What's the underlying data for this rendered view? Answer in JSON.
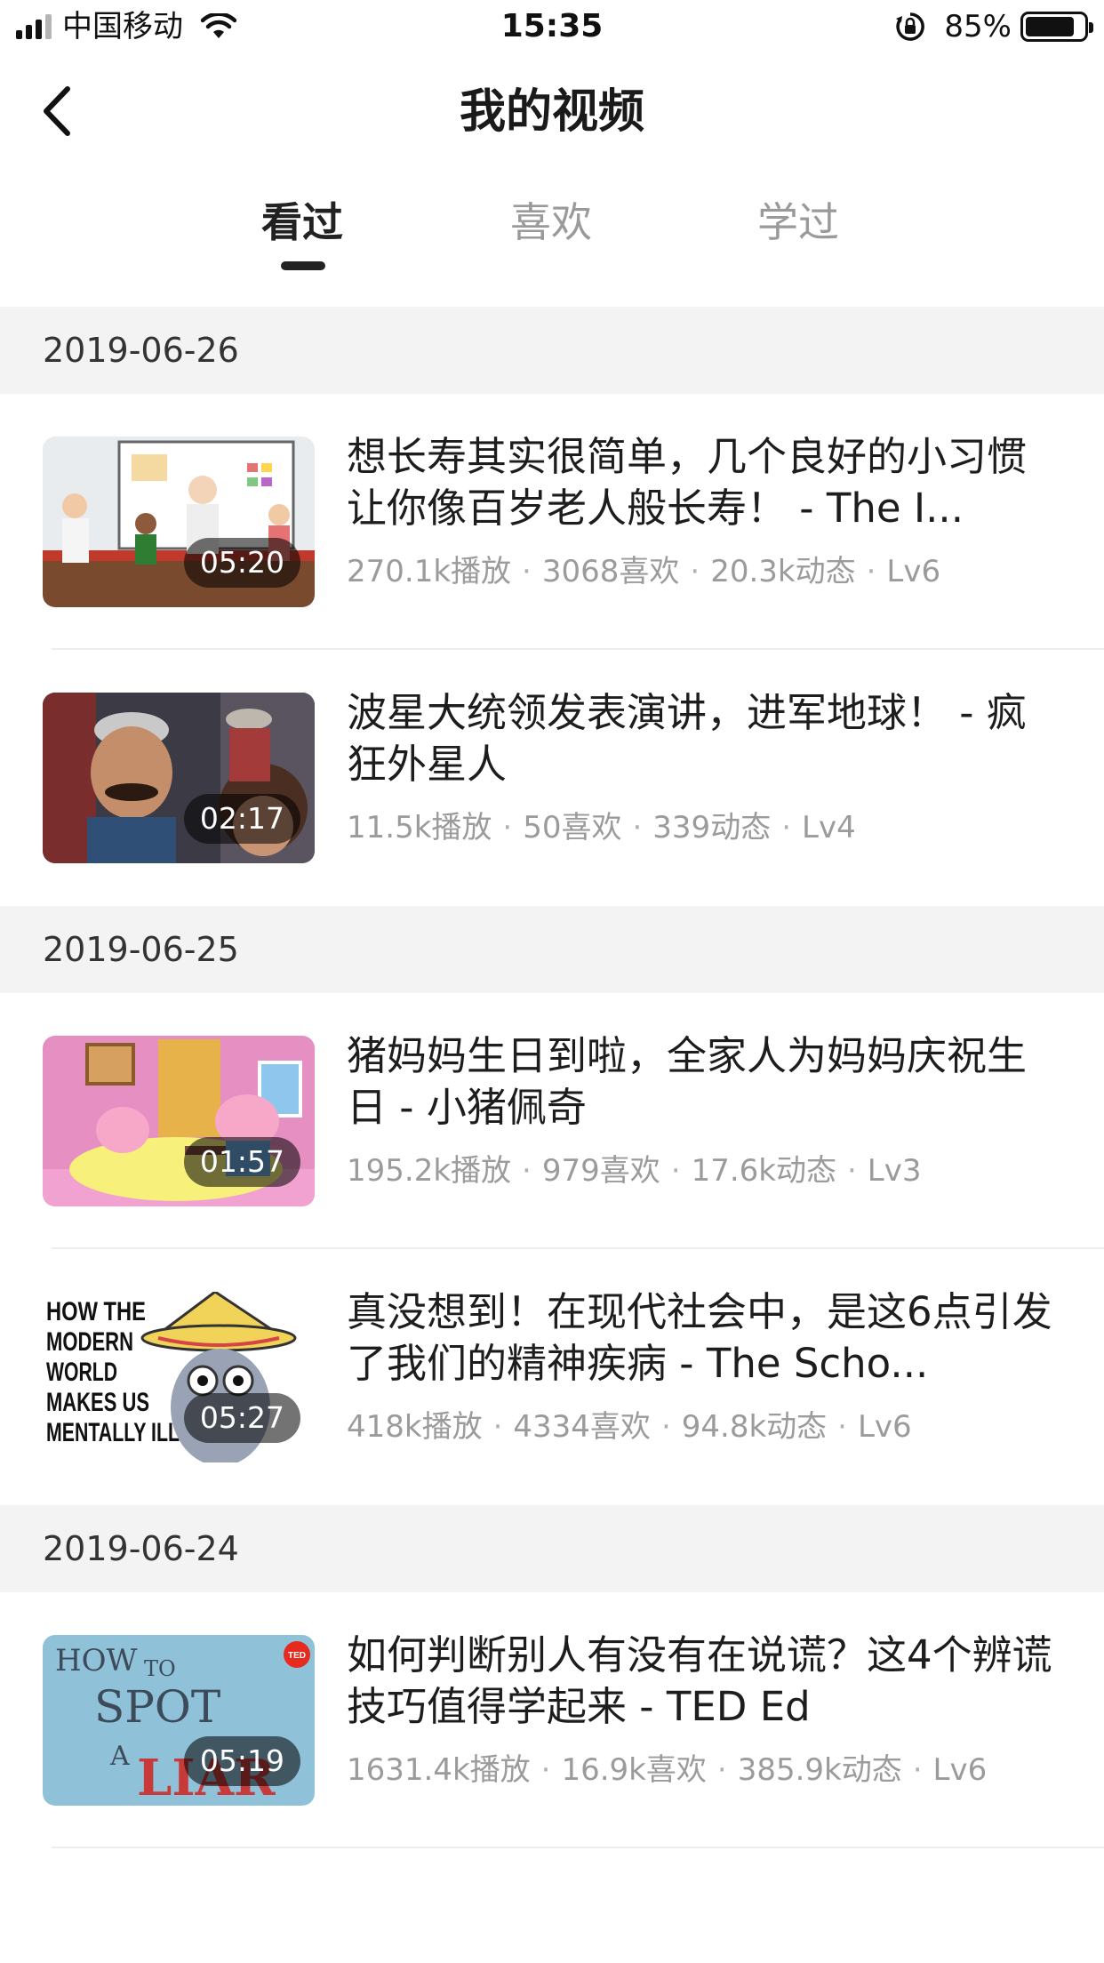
{
  "status_bar": {
    "carrier": "中国移动",
    "time": "15:35",
    "battery": "85%",
    "battery_level": 0.85
  },
  "nav": {
    "title": "我的视频",
    "back_icon": "chevron-left-icon"
  },
  "tabs": [
    {
      "label": "看过",
      "active": true
    },
    {
      "label": "喜欢",
      "active": false
    },
    {
      "label": "学过",
      "active": false
    }
  ],
  "groups": [
    {
      "date": "2019-06-26",
      "items": [
        {
          "title": "想长寿其实很简单，几个良好的小习惯让你像百岁老人般长寿！ - The I...",
          "duration": "05:20",
          "plays": "270.1k播放",
          "likes": "3068喜欢",
          "activity": "20.3k动态",
          "level": "Lv6"
        },
        {
          "title": "波星大统领发表演讲，进军地球！ - 疯狂外星人",
          "duration": "02:17",
          "plays": "11.5k播放",
          "likes": "50喜欢",
          "activity": "339动态",
          "level": "Lv4"
        }
      ]
    },
    {
      "date": "2019-06-25",
      "items": [
        {
          "title": "猪妈妈生日到啦，全家人为妈妈庆祝生日 - 小猪佩奇",
          "duration": "01:57",
          "plays": "195.2k播放",
          "likes": "979喜欢",
          "activity": "17.6k动态",
          "level": "Lv3"
        },
        {
          "title": "真没想到！在现代社会中，是这6点引发了我们的精神疾病 - The Scho...",
          "duration": "05:27",
          "plays": "418k播放",
          "likes": "4334喜欢",
          "activity": "94.8k动态",
          "level": "Lv6",
          "thumb_text": [
            "HOW THE",
            "MODERN",
            "WORLD",
            "MAKES US",
            "MENTALLY ILL"
          ]
        }
      ]
    },
    {
      "date": "2019-06-24",
      "items": [
        {
          "title": "如何判断别人有没有在说谎？这4个辨谎技巧值得学起来 - TED Ed",
          "duration": "05:19",
          "plays": "1631.4k播放",
          "likes": "16.9k喜欢",
          "activity": "385.9k动态",
          "level": "Lv6",
          "thumb_text": [
            "HOW",
            "TO",
            "SPOT",
            "A",
            "LIAR",
            "TED"
          ]
        }
      ]
    }
  ],
  "meta_separator": "·"
}
